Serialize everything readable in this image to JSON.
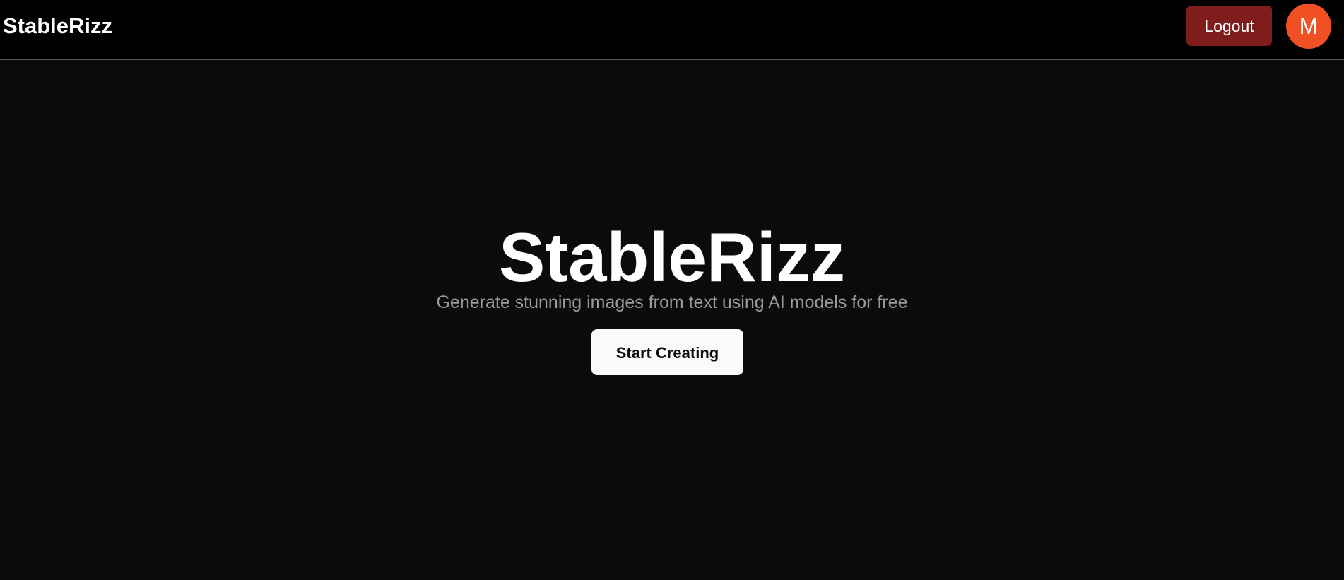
{
  "navbar": {
    "brand": "StableRizz",
    "logout_label": "Logout",
    "avatar_initial": "M"
  },
  "hero": {
    "title": "StableRizz",
    "subtitle": "Generate stunning images from text using AI models for free",
    "cta_label": "Start Creating"
  },
  "colors": {
    "page_background": "#0b0b0b",
    "navbar_background": "#000000",
    "logout_button": "#7f1d1d",
    "avatar": "#f05023",
    "cta_button": "#fafafa"
  }
}
